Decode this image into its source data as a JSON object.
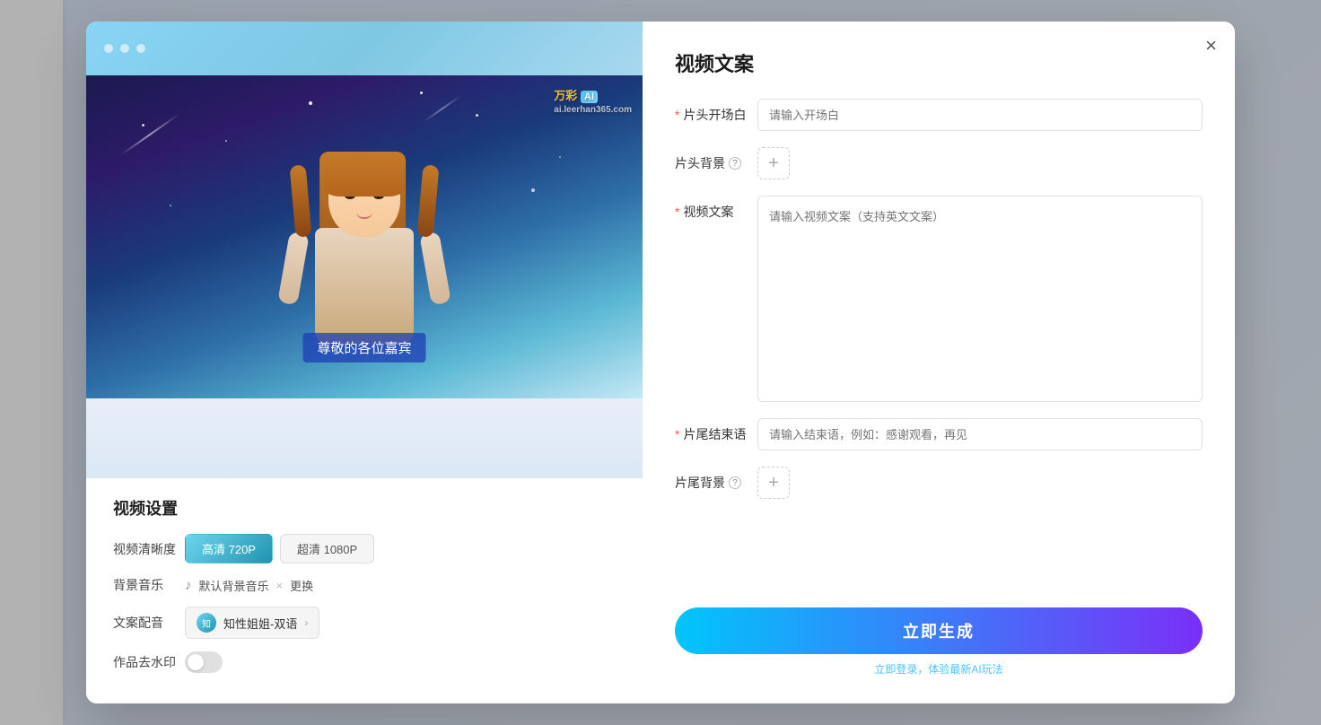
{
  "modal": {
    "close_label": "×",
    "left": {
      "watermark_text": "万彩",
      "watermark_ai": "AI",
      "watermark_site": "ai.leerhan365.com",
      "subtitle": "尊敬的各位嘉宾",
      "settings_title": "视频设置",
      "quality_label": "视频清晰度",
      "quality_options": [
        {
          "label": "高清 720P",
          "active": true
        },
        {
          "label": "超清 1080P",
          "active": false
        }
      ],
      "music_label": "背景音乐",
      "music_name": "默认背景音乐",
      "music_change": "更换",
      "voice_label": "文案配音",
      "voice_name": "知性姐姐-双语",
      "watermark_label": "作品去水印"
    },
    "right": {
      "panel_title": "视频文案",
      "opening_label": "片头开场白",
      "opening_placeholder": "请输入开场白",
      "opening_required": true,
      "header_bg_label": "片头背景",
      "header_bg_add": "+",
      "script_label": "视频文案",
      "script_placeholder": "请输入视频文案（支持英文文案）",
      "script_required": true,
      "ending_label": "片尾结束语",
      "ending_placeholder": "请输入结束语，例如：感谢观看，再见",
      "ending_required": true,
      "footer_bg_label": "片尾背景",
      "footer_bg_add": "+",
      "generate_btn": "立即生成",
      "login_hint": "立即登录，体验最新AI玩法"
    }
  }
}
